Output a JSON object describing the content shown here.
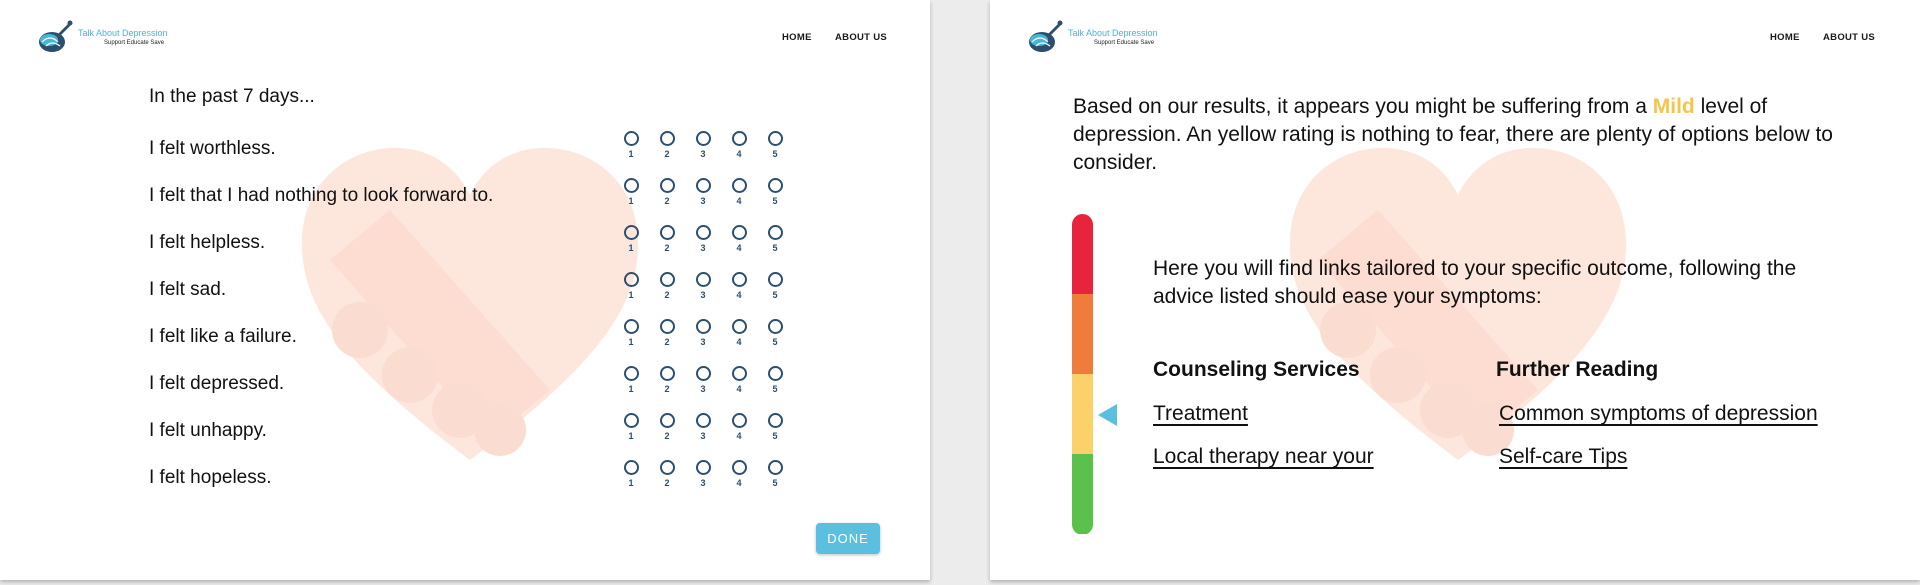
{
  "brand": {
    "title": "Talk About Depression",
    "tagline": "Support Educate Save",
    "accent": "#46b6d9"
  },
  "nav": {
    "home": "HOME",
    "about": "ABOUT US"
  },
  "survey": {
    "prompt": "In the past 7 days...",
    "scale": [
      "1",
      "2",
      "3",
      "4",
      "5"
    ],
    "questions": [
      "I felt worthless.",
      "I felt that I had nothing to look forward to.",
      "I felt helpless.",
      "I felt sad.",
      "I felt like a failure.",
      "I felt depressed.",
      "I felt unhappy.",
      "I felt hopeless."
    ],
    "done_label": "DONE"
  },
  "result": {
    "line_before": "Based on our results, it appears you might be suffering from a ",
    "level": "Mild",
    "line_after": " level of depression.  An yellow rating is nothing to fear, there are plenty of options below to consider.",
    "intro": "Here you will find links tailored to your specific outcome, following the advice listed should ease your symptoms:",
    "gauge_colors": [
      "#e8243c",
      "#f07c3c",
      "#fdd16a",
      "#5cc04c"
    ],
    "gauge_level_index": 2,
    "columns": [
      {
        "heading": "Counseling Services",
        "links": [
          "Treatment",
          "Local therapy near your"
        ]
      },
      {
        "heading": "Further Reading",
        "links": [
          "Common symptoms of depression",
          "Self-care Tips"
        ]
      }
    ]
  }
}
